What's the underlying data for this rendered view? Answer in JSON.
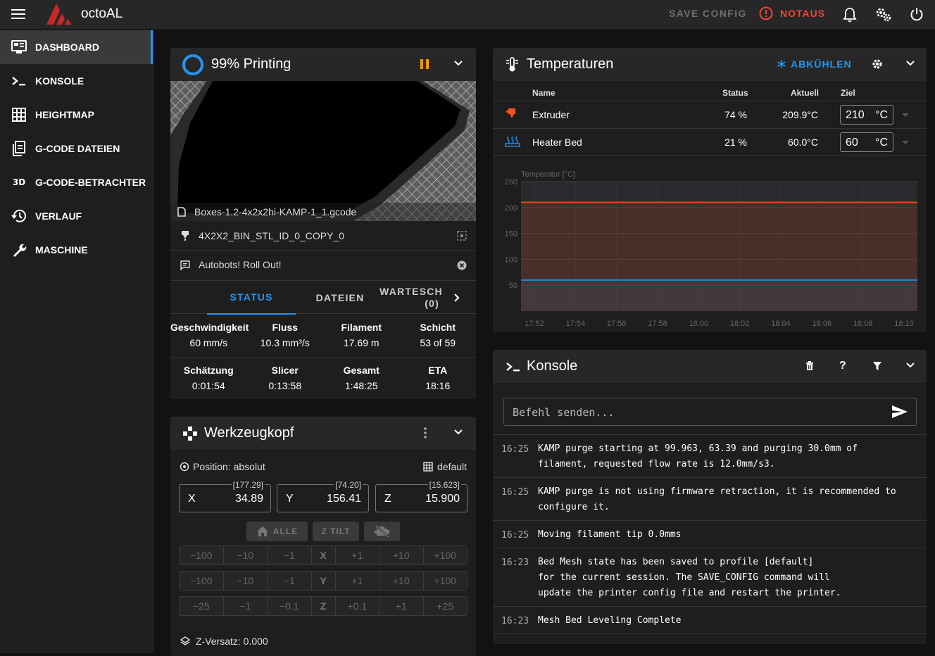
{
  "topbar": {
    "app_title": "octoAL",
    "save_config": "SAVE CONFIG",
    "notaus": "NOTAUS"
  },
  "sidebar": {
    "items": [
      {
        "label": "DASHBOARD",
        "icon": "monitor-dashboard-icon",
        "active": true
      },
      {
        "label": "KONSOLE",
        "icon": "console-icon"
      },
      {
        "label": "HEIGHTMAP",
        "icon": "grid-icon"
      },
      {
        "label": "G-CODE DATEIEN",
        "icon": "file-document-icon"
      },
      {
        "label": "G-CODE-BETRACHTER",
        "icon": "3d-icon",
        "icon_text": "3D"
      },
      {
        "label": "VERLAUF",
        "icon": "history-icon"
      },
      {
        "label": "MASCHINE",
        "icon": "wrench-icon"
      }
    ]
  },
  "status": {
    "title": "99% Printing",
    "progress": 0.99,
    "filename": "Boxes-1.2-4x2x2hi-KAMP-1_1.gcode",
    "object": "4X2X2_BIN_STL_ID_0_COPY_0",
    "message": "Autobots! Roll Out!",
    "tabs": [
      "STATUS",
      "DATEIEN",
      "WARTESCH",
      "(0)"
    ],
    "row1": [
      {
        "label": "Geschwindigkeit",
        "value": "60 mm/s"
      },
      {
        "label": "Fluss",
        "value": "10.3 mm³/s"
      },
      {
        "label": "Filament",
        "value": "17.69 m"
      },
      {
        "label": "Schicht",
        "value": "53 of 59"
      }
    ],
    "row2": [
      {
        "label": "Schätzung",
        "value": "0:01:54"
      },
      {
        "label": "Slicer",
        "value": "0:13:58"
      },
      {
        "label": "Gesamt",
        "value": "1:48:25"
      },
      {
        "label": "ETA",
        "value": "18:16"
      }
    ]
  },
  "toolhead": {
    "title": "Werkzeugkopf",
    "position_label": "Position: absolut",
    "mesh_label": "default",
    "axes": [
      {
        "name": "X",
        "value": "34.89",
        "bracket": "[177.29]"
      },
      {
        "name": "Y",
        "value": "156.41",
        "bracket": "[74.20]"
      },
      {
        "name": "Z",
        "value": "15.900",
        "bracket": "[15.623]"
      }
    ],
    "home_all": "ALLE",
    "z_tilt": "Z TILT",
    "jog_xy": [
      "−100",
      "−10",
      "−1",
      "+1",
      "+10",
      "+100"
    ],
    "jog_z": [
      "−25",
      "−1",
      "−0.1",
      "+0.1",
      "+1",
      "+25"
    ],
    "z_offset": "Z-Versatz: 0.000"
  },
  "temps": {
    "title": "Temperaturen",
    "cooldown": "ABKÜHLEN",
    "headers": {
      "name": "Name",
      "status": "Status",
      "actual": "Aktuell",
      "target": "Ziel"
    },
    "rows": [
      {
        "name": "Extruder",
        "status": "74 %",
        "actual": "209.9°C",
        "target": "210",
        "unit": "°C",
        "color": "#f4511e"
      },
      {
        "name": "Heater Bed",
        "status": "21 %",
        "actual": "60.0°C",
        "target": "60",
        "unit": "°C",
        "color": "#1e88e5"
      }
    ]
  },
  "chart_data": {
    "type": "line",
    "ylabel": "Temperatur [°C]",
    "ylim": [
      0,
      250
    ],
    "yticks": [
      50,
      100,
      150,
      200,
      250
    ],
    "x": [
      "17:52",
      "17:54",
      "17:56",
      "17:58",
      "18:00",
      "18:02",
      "18:04",
      "18:06",
      "18:08",
      "18:10"
    ],
    "series": [
      {
        "values": [
          210,
          210,
          210,
          210,
          210,
          210,
          210,
          210,
          210,
          210
        ],
        "color": "#e64a19"
      },
      {
        "values": [
          60,
          60,
          60,
          60,
          60,
          60,
          60,
          60,
          60,
          60
        ],
        "color": "#1e88e5"
      }
    ],
    "grid": true
  },
  "console": {
    "title": "Konsole",
    "placeholder": "Befehl senden...",
    "entries": [
      {
        "time": "16:25",
        "text": "KAMP purge starting at 99.963, 63.39 and purging 30.0mm of\nfilament, requested flow rate is 12.0mm/s3."
      },
      {
        "time": "16:25",
        "text": "KAMP purge is not using firmware retraction, it is recommended to\nconfigure it."
      },
      {
        "time": "16:25",
        "text": "Moving filament tip 0.0mms"
      },
      {
        "time": "16:23",
        "text": "Bed Mesh state has been saved to profile [default]\nfor the current session. The SAVE_CONFIG command will\nupdate the printer config file and restart the printer."
      },
      {
        "time": "16:23",
        "text": "Mesh Bed Leveling Complete"
      }
    ]
  }
}
